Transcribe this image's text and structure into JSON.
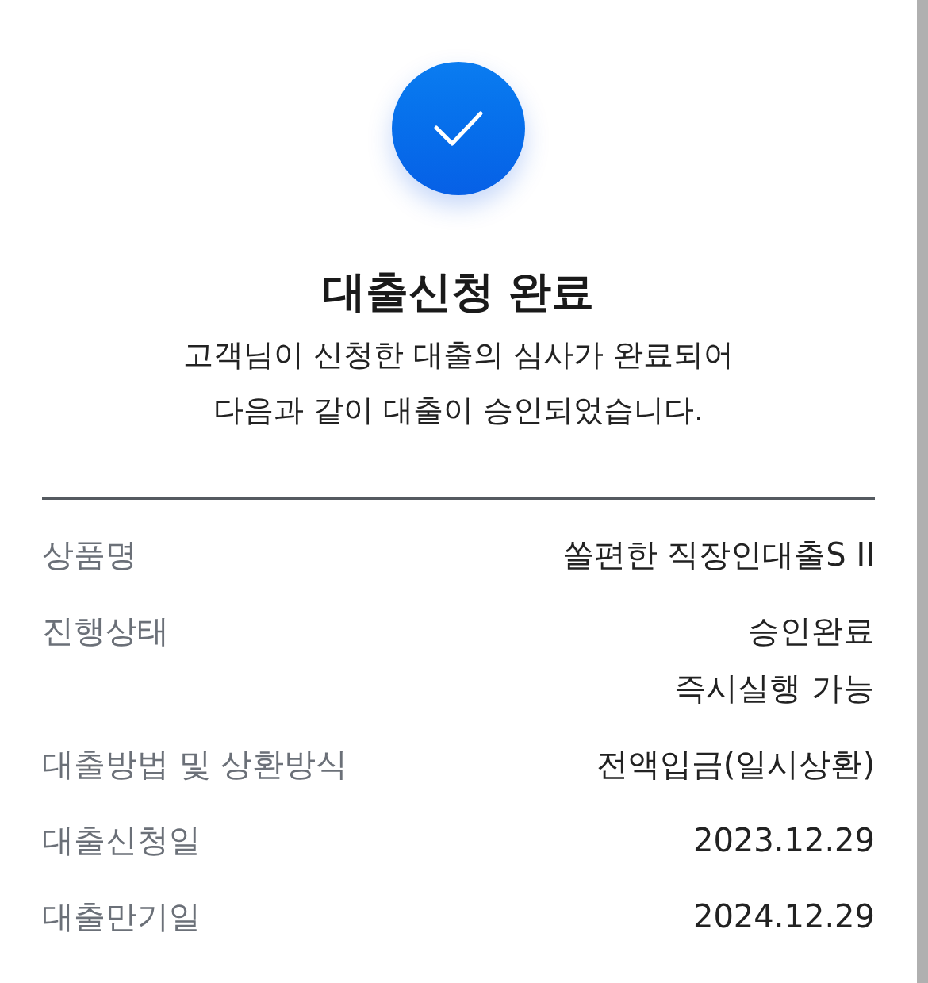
{
  "title": "대출신청 완료",
  "message_lines": [
    "고객님이 신청한 대출의 심사가 완료되어",
    "다음과 같이 대출이 승인되었습니다."
  ],
  "details": [
    {
      "label": "상품명",
      "values": [
        "쏠편한 직장인대출S II"
      ]
    },
    {
      "label": "진행상태",
      "values": [
        "승인완료",
        "즉시실행 가능"
      ]
    },
    {
      "label": "대출방법 및 상환방식",
      "values": [
        "전액입금(일시상환)"
      ]
    },
    {
      "label": "대출신청일",
      "values": [
        "2023.12.29"
      ]
    },
    {
      "label": "대출만기일",
      "values": [
        "2024.12.29"
      ]
    }
  ]
}
